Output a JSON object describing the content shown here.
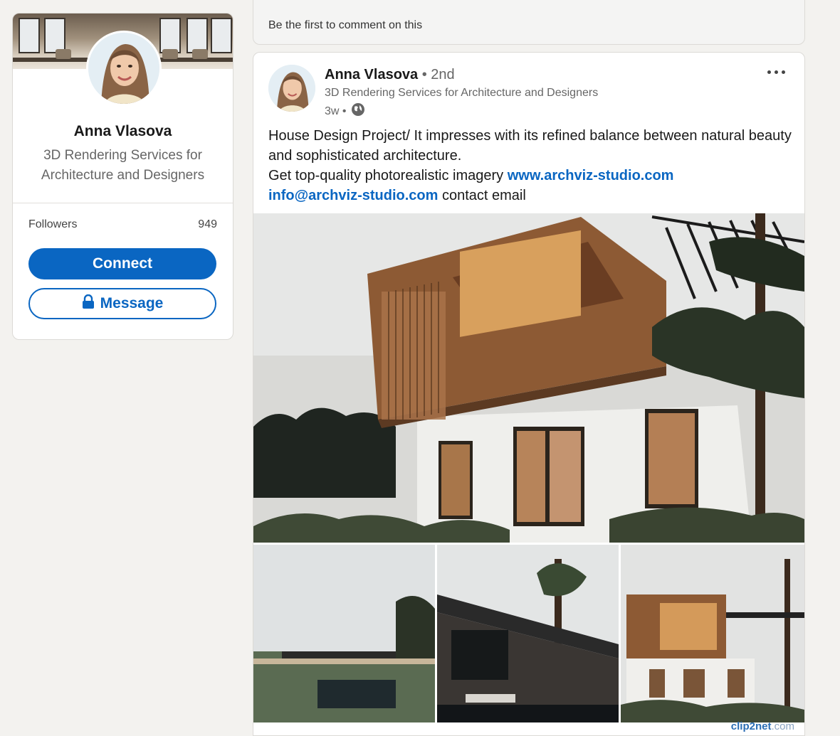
{
  "profile": {
    "name": "Anna Vlasova",
    "headline": "3D Rendering Services for Architecture and Designers",
    "followers_label": "Followers",
    "followers_count": "949",
    "connect_label": "Connect",
    "message_label": "Message"
  },
  "comments": {
    "empty_text": "Be the first to comment on this"
  },
  "post": {
    "author_name": "Anna Vlasova",
    "author_degree": "• 2nd",
    "author_headline": "3D Rendering Services for Architecture and Designers",
    "time": "3w •",
    "body_line1": "House Design Project/ It impresses with its refined balance between natural beauty and sophisticated architecture.",
    "body_line2": "Get top-quality photorealistic imagery",
    "link_website": "www.archviz-studio.com",
    "link_email": "info@archviz-studio.com",
    "email_suffix": "contact email"
  },
  "watermark": {
    "brand": "clip2net",
    "tld": ".com"
  },
  "colors": {
    "brand_blue": "#0a66c2",
    "page_bg": "#f3f2ef"
  },
  "icons": [
    "more-icon",
    "globe-icon",
    "lock-icon"
  ]
}
